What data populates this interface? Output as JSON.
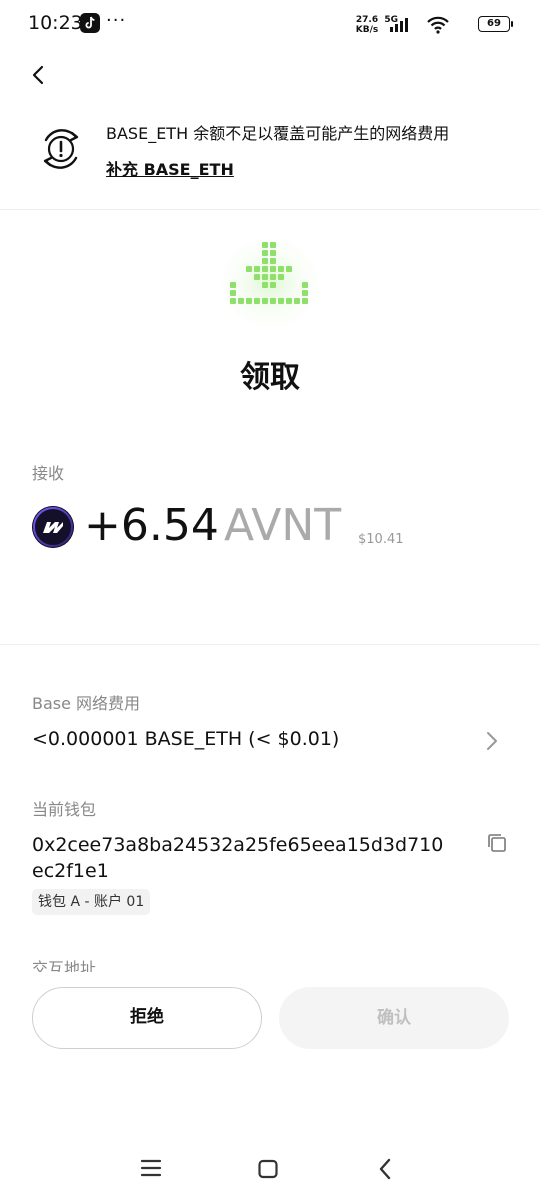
{
  "status_bar": {
    "time": "10:23",
    "more": "···",
    "net_speed_value": "27.6",
    "net_speed_unit": "KB/s",
    "signal_label": "5G",
    "battery": "69"
  },
  "warning": {
    "icon": "alert-circle-icon",
    "text": "BASE_ETH 余额不足以覆盖可能产生的网络费用",
    "link": "补充 BASE_ETH"
  },
  "hero": {
    "icon": "pixel-download-icon",
    "title": "领取"
  },
  "receive": {
    "label": "接收",
    "amount": "+6.54",
    "symbol": "AVNT",
    "usd": "$10.41"
  },
  "fee": {
    "label": "Base 网络费用",
    "value": "<0.000001 BASE_ETH (< $0.01)"
  },
  "wallet": {
    "label": "当前钱包",
    "address": "0x2cee73a8ba24532a25fe65eea15d3d710ec2f1e1",
    "badge": "钱包 A - 账户 01"
  },
  "interaction": {
    "label": "交互地址"
  },
  "buttons": {
    "reject": "拒绝",
    "confirm": "确认"
  },
  "colors": {
    "accent_green": "#8ee06a",
    "disabled_text": "#c0c0c0",
    "muted_text": "#888888"
  }
}
